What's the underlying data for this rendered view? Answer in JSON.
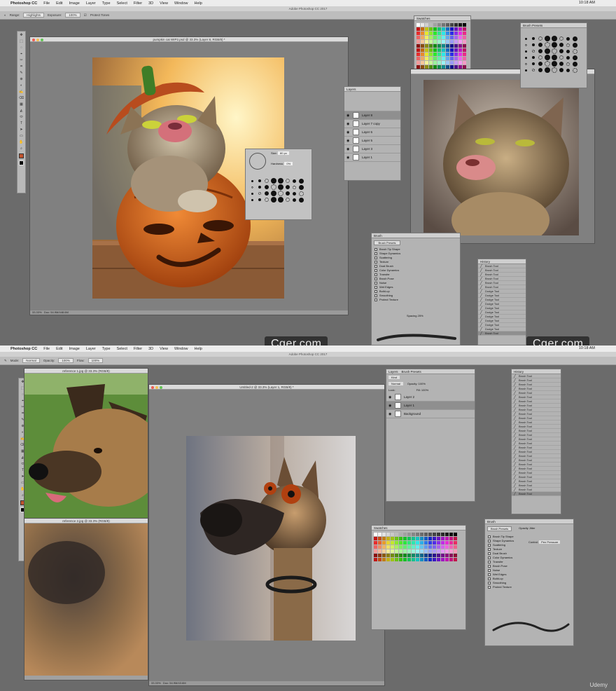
{
  "app_menu": [
    "Photoshop CC",
    "File",
    "Edit",
    "Image",
    "Layer",
    "Type",
    "Select",
    "Filter",
    "3D",
    "View",
    "Window",
    "Help"
  ],
  "app_title": "Adobe Photoshop CC 2017",
  "clock": "10:18 AM",
  "top": {
    "options": {
      "range_label": "Range:",
      "range_value": "Highlights",
      "exposure_label": "Exposure:",
      "exposure_value": "100%",
      "protect": "Protect Tones"
    },
    "doc_title": "pumpkin cat WIP2.psd @ 33.3% (Layer 8, RGB/8) *",
    "doc_zoom": "33.33%",
    "doc_info": "Doc: 54.9M/448.6M",
    "panels": {
      "swatches": "Swatches",
      "brush_presets": "Brush Presets",
      "layers": "Layers",
      "layer_names": [
        "Layer 8",
        "Layer 7 copy",
        "Layer 6",
        "Layer 5",
        "Layer 3",
        "Layer 1"
      ],
      "brush": "Brush",
      "brush_presets_btn": "Brush Presets",
      "brush_options": [
        "Brush Tip Shape",
        "Shape Dynamics",
        "Scattering",
        "Texture",
        "Dual Brush",
        "Color Dynamics",
        "Transfer",
        "Brush Pose",
        "Noise",
        "Wet Edges",
        "Build-up",
        "Smoothing",
        "Protect Texture"
      ],
      "history": "History",
      "history_items": [
        "Brush Tool",
        "Brush Tool",
        "Brush Tool",
        "Brush Tool",
        "Brush Tool",
        "Brush Tool",
        "Dodge Tool",
        "Dodge Tool",
        "Dodge Tool",
        "Dodge Tool",
        "Dodge Tool",
        "Dodge Tool",
        "Dodge Tool",
        "Dodge Tool",
        "Dodge Tool",
        "Dodge Tool",
        "Brush Tool"
      ],
      "size_label": "Size:",
      "size_value": "80 px",
      "hardness_label": "Hardness:",
      "hardness_value": "0%",
      "spacing_label": "Spacing",
      "spacing_value": "25%"
    }
  },
  "bottom": {
    "options": {
      "mode_label": "Mode:",
      "mode_value": "Normal",
      "opacity_label": "Opacity:",
      "opacity_value": "100%",
      "flow_label": "Flow:",
      "flow_value": "100%"
    },
    "ref1_title": "reference 1.jpg @ 33.3% (RGB/8)",
    "ref2_title": "reference 2.jpg @ 33.3% (RGB/8)",
    "doc_title": "Untitled-2 @ 33.3% (Layer 1, RGB/8) *",
    "doc_zoom": "33.33%",
    "doc_info": "Doc: 54.9M/43.6M",
    "panels": {
      "layers": "Layers",
      "brush_presets_tab": "Brush Presets",
      "kind": "Kind",
      "blend": "Normal",
      "opacity": "Opacity: 100%",
      "lock": "Lock:",
      "fill": "Fill: 100%",
      "layer_names": [
        "Layer 2",
        "Layer 1",
        "Background"
      ],
      "swatches": "Swatches",
      "history": "History",
      "history_items": [
        "Brush Tool",
        "Brush Tool",
        "Brush Tool",
        "Brush Tool",
        "Brush Tool",
        "Brush Tool",
        "Brush Tool",
        "Brush Tool",
        "Brush Tool",
        "Brush Tool",
        "Brush Tool",
        "Brush Tool",
        "Brush Tool",
        "Brush Tool",
        "Brush Tool",
        "Brush Tool",
        "Brush Tool",
        "Brush Tool",
        "Brush Tool",
        "Brush Tool",
        "Brush Tool",
        "Brush Tool",
        "Brush Tool",
        "Brush Tool",
        "Brush Tool",
        "Brush Tool",
        "Brush Tool",
        "Brush Tool",
        "Brush Tool"
      ],
      "brush": "Brush",
      "brush_presets_btn": "Brush Presets",
      "opacity_jitter": "Opacity Jitter",
      "control_label": "Control:",
      "control_value": "Pen Pressure",
      "brush_options": [
        "Brush Tip Shape",
        "Shape Dynamics",
        "Scattering",
        "Texture",
        "Dual Brush",
        "Color Dynamics",
        "Transfer",
        "Brush Pose",
        "Noise",
        "Wet Edges",
        "Build-up",
        "Smoothing",
        "Protect Texture"
      ]
    }
  },
  "watermark_text": "Cger.com",
  "udemy": "Udemy",
  "colors": {
    "bg": "#6b6b6b",
    "panel": "#b3b3b3",
    "accent_pumpkin": "#d2691e"
  }
}
